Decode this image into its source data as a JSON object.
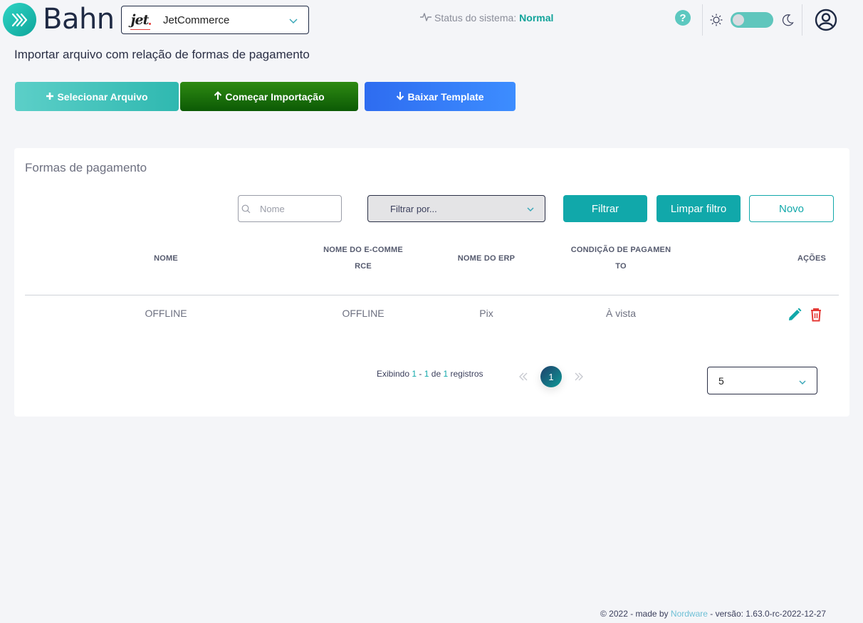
{
  "header": {
    "logo_text": "Bahn",
    "company": {
      "logo_text": "jet",
      "name": "JetCommerce"
    },
    "status_label": "Status do sistema:",
    "status_value": "Normal",
    "help_label": "?"
  },
  "page": {
    "title": "Importar arquivo com relação de formas de pagamento"
  },
  "actions": {
    "select_file": "Selecionar Arquivo",
    "start_import": "Começar Importação",
    "download_template": "Baixar Template"
  },
  "card": {
    "title": "Formas de pagamento",
    "search_placeholder": "Nome",
    "filter_select": "Filtrar por...",
    "filter_button": "Filtrar",
    "clear_button": "Limpar filtro",
    "new_button": "Novo"
  },
  "table": {
    "headers": {
      "nome": "NOME",
      "ecommerce_1": "NOME DO E-COMME",
      "ecommerce_2": "RCE",
      "erp": "NOME DO ERP",
      "condicao_1": "CONDIÇÃO DE PAGAMEN",
      "condicao_2": "TO",
      "acoes": "AÇÕES"
    },
    "rows": [
      {
        "nome": "OFFLINE",
        "ecommerce": "OFFLINE",
        "erp": "Pix",
        "condicao": "À vista"
      }
    ]
  },
  "pagination": {
    "prefix": "Exibindo",
    "from": "1",
    "dash": "-",
    "to": "1",
    "of": "de",
    "total": "1",
    "suffix": "registros",
    "current_page": "1",
    "page_size": "5"
  },
  "footer": {
    "prefix": "© 2022 - made by",
    "brand": "Nordware",
    "version": "- versão: 1.63.0-rc-2022-12-27"
  },
  "colors": {
    "accent": "#11a8aa",
    "status_ok": "#11a39a",
    "import_button": "#1a6e0a",
    "download_button": "#3478f6",
    "delete": "#e53935"
  },
  "icons": {
    "logo": "chevrons-right-icon",
    "help": "question-circle-icon",
    "theme_light": "sun-icon",
    "theme_dark": "moon-icon",
    "user": "user-circle-icon",
    "edit": "pencil-icon",
    "delete": "trash-icon"
  }
}
